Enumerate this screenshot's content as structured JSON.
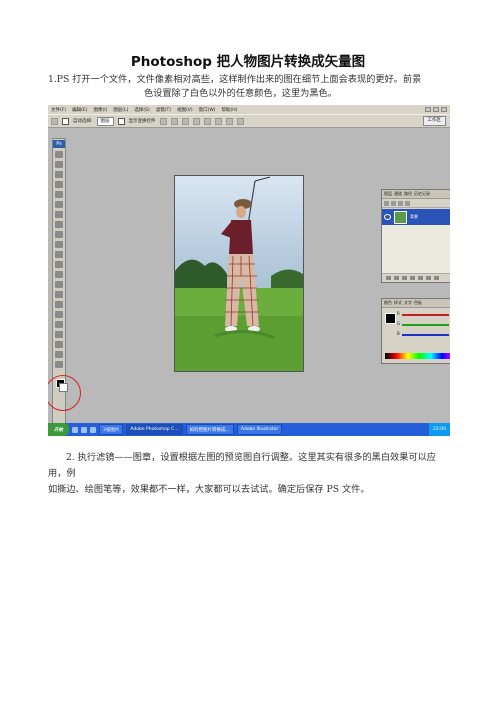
{
  "title": "Photoshop 把人物图片转换成矢量图",
  "step1": {
    "line1": "1.PS 打开一个文件，文件像素相对高些，这样制作出来的图在细节上面会表现的更好。前景",
    "line2": "色设置除了白色以外的任意颜色，这里为黑色。"
  },
  "step2": {
    "line1": "2. 执行滤镜——图章，设置根据左图的预览图自行调整。这里其实有很多的黑白效果可以应用，例",
    "line2": "如撕边、绘图笔等，效果都不一样，大家都可以去试试。确定后保存 PS 文件。"
  },
  "screenshot": {
    "menu": [
      "文件(F)",
      "编辑(E)",
      "图像(I)",
      "图层(L)",
      "选择(S)",
      "滤镜(T)",
      "视图(V)",
      "窗口(W)",
      "帮助(H)"
    ],
    "options": {
      "auto_select": "自动选择:",
      "auto_select_value": "图层",
      "show_transform": "显示变换控件",
      "workspace": "工作区"
    },
    "toolbox_label": "Ps",
    "layers_panel": {
      "tabs": [
        "图层",
        "通道",
        "路径",
        "历史记录"
      ],
      "layer_name": "背景"
    },
    "color_panel": {
      "tabs": [
        "颜色",
        "样式",
        "文字",
        "色板"
      ],
      "channels": [
        "R",
        "G",
        "B"
      ],
      "values": [
        "0",
        "0",
        "0"
      ]
    },
    "taskbar": {
      "start": "开始",
      "tasks": [
        "3张图片",
        "Adobe Photoshop C...",
        "如何把图片转换成...",
        "Adobe Illustrator"
      ],
      "clock": "22:00"
    },
    "colors": {
      "annotation_circle": "#d62020",
      "taskbar": "#245edb",
      "layer_selected": "#2a54b8"
    }
  }
}
